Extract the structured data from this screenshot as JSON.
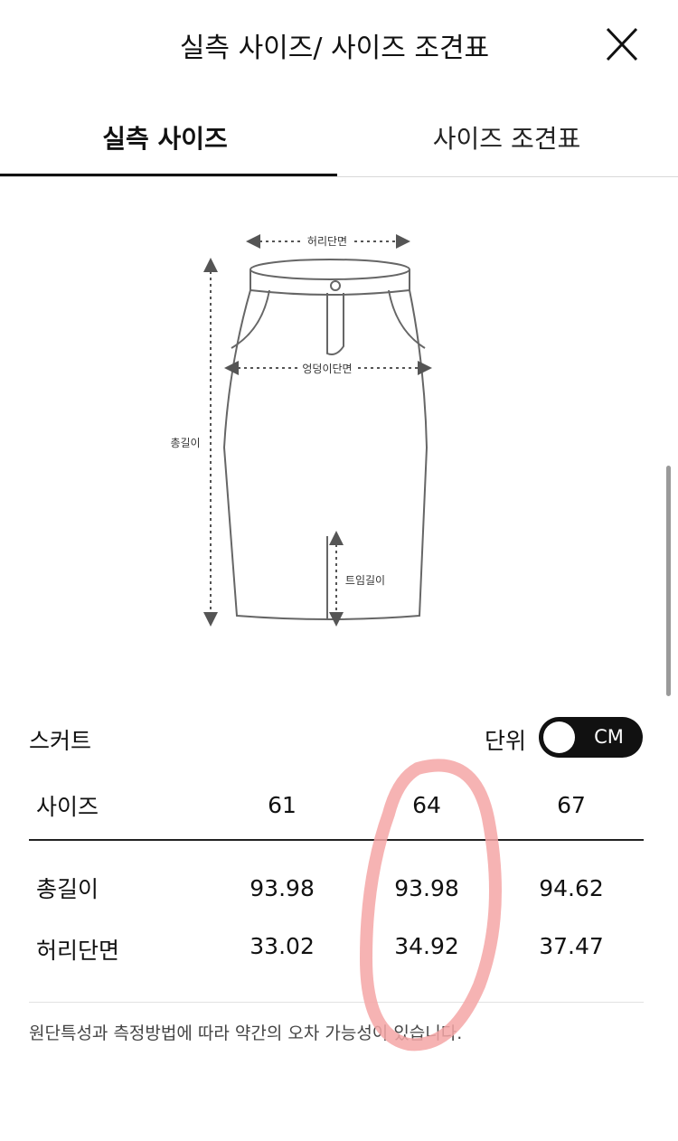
{
  "header": {
    "title": "실측 사이즈/ 사이즈 조견표",
    "close_icon": "close-icon"
  },
  "tabs": [
    {
      "label": "실측 사이즈",
      "active": true
    },
    {
      "label": "사이즈 조견표",
      "active": false
    }
  ],
  "diagram": {
    "labels": {
      "waist": "허리단면",
      "hip": "엉덩이단면",
      "total_length": "총길이",
      "slit_length": "트임길이"
    }
  },
  "section": {
    "title": "스커트",
    "unit_label": "단위",
    "unit_value": "CM"
  },
  "table": {
    "header_label": "사이즈",
    "sizes": [
      "61",
      "64",
      "67"
    ],
    "rows": [
      {
        "label": "총길이",
        "values": [
          "93.98",
          "93.98",
          "94.62"
        ]
      },
      {
        "label": "허리단면",
        "values": [
          "33.02",
          "34.92",
          "37.47"
        ]
      }
    ]
  },
  "footnote": "원단특성과 측정방법에 따라 약간의 오차 가능성이 있습니다.",
  "colors": {
    "annotation": "#f4a6a6",
    "toggle": "#111111"
  }
}
